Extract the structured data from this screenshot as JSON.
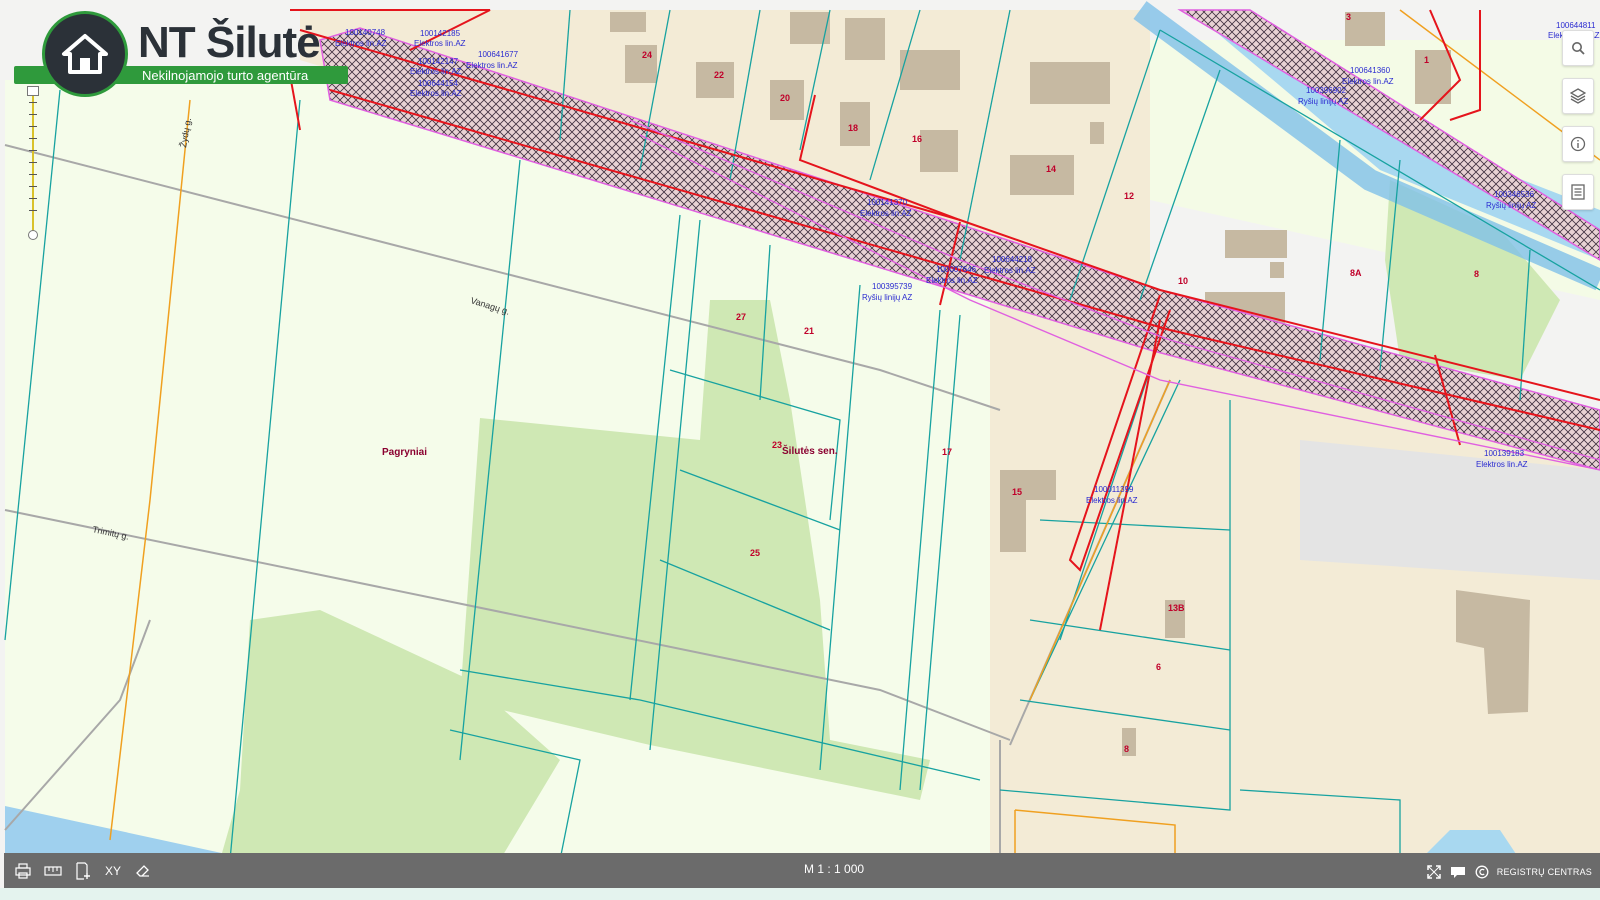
{
  "logo": {
    "title": "NT Šilutė",
    "subtitle": "Nekilnojamojo turto agentūra"
  },
  "map": {
    "scale_label": "M 1 : 1 000",
    "place_labels": [
      "Pagryniai",
      "Šilutės sen."
    ],
    "street_labels": [
      "Vanagų g.",
      "Trimitų g.",
      "Žydų g."
    ],
    "parcel_numbers": [
      "24",
      "22",
      "20",
      "18",
      "16",
      "14",
      "12",
      "10",
      "8A",
      "8",
      "27",
      "21",
      "23",
      "17",
      "25",
      "15",
      "13B",
      "6",
      "8",
      "3",
      "1"
    ],
    "utility_labels": [
      {
        "id": "100140748",
        "type": "Elektros lin.AZ"
      },
      {
        "id": "100142185",
        "type": "Elektros lin.AZ"
      },
      {
        "id": "100142147",
        "type": "Elektros lin.AZ"
      },
      {
        "id": "100641677",
        "type": "Elektros lin.AZ"
      },
      {
        "id": "100644154",
        "type": "Elektros lin.AZ"
      },
      {
        "id": "100141370",
        "type": "Elektros lin.AZ"
      },
      {
        "id": "100644218",
        "type": "Elektros lin.AZ"
      },
      {
        "id": "100007646",
        "type": "Elektros lin.AZ"
      },
      {
        "id": "100395739",
        "type": "Ryšių linijų AZ"
      },
      {
        "id": "100011399",
        "type": "Elektros lin.AZ"
      },
      {
        "id": "100641360",
        "type": "Elektros lin.AZ"
      },
      {
        "id": "100396902",
        "type": "Ryšių linijų AZ"
      },
      {
        "id": "100346536",
        "type": "Ryšių linijų AZ"
      },
      {
        "id": "100139183",
        "type": "Elektros lin.AZ"
      },
      {
        "id": "100644811",
        "type": "Elektros lin.AZ"
      }
    ]
  },
  "toolbar_right": [
    "search-icon",
    "layers-icon",
    "info-icon",
    "legend-icon"
  ],
  "bottom_bar": {
    "tools": [
      "print-icon",
      "measure-icon",
      "add-page-icon",
      "XY",
      "eraser-icon"
    ],
    "xy_label": "XY",
    "brand": "REGISTRŲ CENTRAS"
  },
  "colors": {
    "parcel_line": "#1aa0a0",
    "power_line": "#e8141e",
    "comm_line": "#e060e0",
    "orange_line": "#f0a020",
    "residential": "#f3ebd8",
    "meadow": "#f3fce0",
    "green_area": "#cde8b0",
    "water": "#a8d8f0",
    "buildings": "#c8b8a0"
  }
}
